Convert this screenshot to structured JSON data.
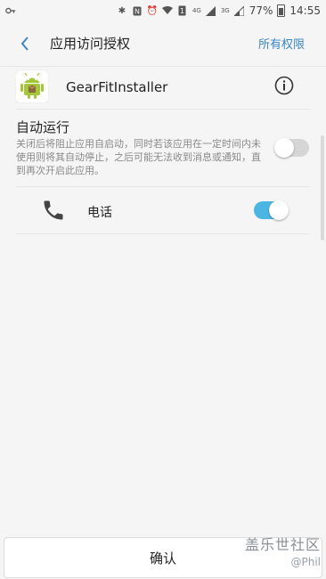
{
  "status_bar": {
    "battery_percent": "77%",
    "time": "14:55",
    "network_4g": "4G",
    "network_3g": "3G",
    "sim_label": "1"
  },
  "header": {
    "title": "应用访问授权",
    "action": "所有权限"
  },
  "app": {
    "name": "GearFitInstaller"
  },
  "autorun": {
    "title": "自动运行",
    "description": "关闭后将阻止应用自启动，同时若该应用在一定时间内未使用则将其自动停止，之后可能无法收到消息或通知，直到再次开启此应用。",
    "enabled": false
  },
  "permissions": [
    {
      "label": "电话",
      "icon": "phone-icon",
      "enabled": true
    }
  ],
  "footer": {
    "confirm_label": "确认"
  },
  "watermark": {
    "line1": "盖乐世社区",
    "line2": "@Phil"
  },
  "colors": {
    "accent": "#3b86c4",
    "switch_on": "#4bb6e3",
    "switch_off": "#d6d6d6",
    "android_green": "#a4c639"
  }
}
